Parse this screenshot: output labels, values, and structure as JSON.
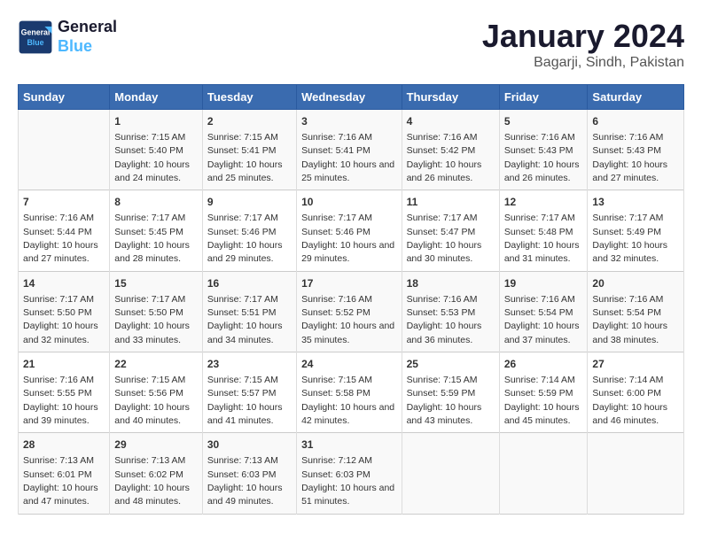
{
  "header": {
    "logo_line1": "General",
    "logo_line2": "Blue",
    "month_year": "January 2024",
    "location": "Bagarji, Sindh, Pakistan"
  },
  "weekdays": [
    "Sunday",
    "Monday",
    "Tuesday",
    "Wednesday",
    "Thursday",
    "Friday",
    "Saturday"
  ],
  "weeks": [
    [
      {
        "day": "",
        "sunrise": "",
        "sunset": "",
        "daylight": ""
      },
      {
        "day": "1",
        "sunrise": "7:15 AM",
        "sunset": "5:40 PM",
        "daylight": "10 hours and 24 minutes."
      },
      {
        "day": "2",
        "sunrise": "7:15 AM",
        "sunset": "5:41 PM",
        "daylight": "10 hours and 25 minutes."
      },
      {
        "day": "3",
        "sunrise": "7:16 AM",
        "sunset": "5:41 PM",
        "daylight": "10 hours and 25 minutes."
      },
      {
        "day": "4",
        "sunrise": "7:16 AM",
        "sunset": "5:42 PM",
        "daylight": "10 hours and 26 minutes."
      },
      {
        "day": "5",
        "sunrise": "7:16 AM",
        "sunset": "5:43 PM",
        "daylight": "10 hours and 26 minutes."
      },
      {
        "day": "6",
        "sunrise": "7:16 AM",
        "sunset": "5:43 PM",
        "daylight": "10 hours and 27 minutes."
      }
    ],
    [
      {
        "day": "7",
        "sunrise": "7:16 AM",
        "sunset": "5:44 PM",
        "daylight": "10 hours and 27 minutes."
      },
      {
        "day": "8",
        "sunrise": "7:17 AM",
        "sunset": "5:45 PM",
        "daylight": "10 hours and 28 minutes."
      },
      {
        "day": "9",
        "sunrise": "7:17 AM",
        "sunset": "5:46 PM",
        "daylight": "10 hours and 29 minutes."
      },
      {
        "day": "10",
        "sunrise": "7:17 AM",
        "sunset": "5:46 PM",
        "daylight": "10 hours and 29 minutes."
      },
      {
        "day": "11",
        "sunrise": "7:17 AM",
        "sunset": "5:47 PM",
        "daylight": "10 hours and 30 minutes."
      },
      {
        "day": "12",
        "sunrise": "7:17 AM",
        "sunset": "5:48 PM",
        "daylight": "10 hours and 31 minutes."
      },
      {
        "day": "13",
        "sunrise": "7:17 AM",
        "sunset": "5:49 PM",
        "daylight": "10 hours and 32 minutes."
      }
    ],
    [
      {
        "day": "14",
        "sunrise": "7:17 AM",
        "sunset": "5:50 PM",
        "daylight": "10 hours and 32 minutes."
      },
      {
        "day": "15",
        "sunrise": "7:17 AM",
        "sunset": "5:50 PM",
        "daylight": "10 hours and 33 minutes."
      },
      {
        "day": "16",
        "sunrise": "7:17 AM",
        "sunset": "5:51 PM",
        "daylight": "10 hours and 34 minutes."
      },
      {
        "day": "17",
        "sunrise": "7:16 AM",
        "sunset": "5:52 PM",
        "daylight": "10 hours and 35 minutes."
      },
      {
        "day": "18",
        "sunrise": "7:16 AM",
        "sunset": "5:53 PM",
        "daylight": "10 hours and 36 minutes."
      },
      {
        "day": "19",
        "sunrise": "7:16 AM",
        "sunset": "5:54 PM",
        "daylight": "10 hours and 37 minutes."
      },
      {
        "day": "20",
        "sunrise": "7:16 AM",
        "sunset": "5:54 PM",
        "daylight": "10 hours and 38 minutes."
      }
    ],
    [
      {
        "day": "21",
        "sunrise": "7:16 AM",
        "sunset": "5:55 PM",
        "daylight": "10 hours and 39 minutes."
      },
      {
        "day": "22",
        "sunrise": "7:15 AM",
        "sunset": "5:56 PM",
        "daylight": "10 hours and 40 minutes."
      },
      {
        "day": "23",
        "sunrise": "7:15 AM",
        "sunset": "5:57 PM",
        "daylight": "10 hours and 41 minutes."
      },
      {
        "day": "24",
        "sunrise": "7:15 AM",
        "sunset": "5:58 PM",
        "daylight": "10 hours and 42 minutes."
      },
      {
        "day": "25",
        "sunrise": "7:15 AM",
        "sunset": "5:59 PM",
        "daylight": "10 hours and 43 minutes."
      },
      {
        "day": "26",
        "sunrise": "7:14 AM",
        "sunset": "5:59 PM",
        "daylight": "10 hours and 45 minutes."
      },
      {
        "day": "27",
        "sunrise": "7:14 AM",
        "sunset": "6:00 PM",
        "daylight": "10 hours and 46 minutes."
      }
    ],
    [
      {
        "day": "28",
        "sunrise": "7:13 AM",
        "sunset": "6:01 PM",
        "daylight": "10 hours and 47 minutes."
      },
      {
        "day": "29",
        "sunrise": "7:13 AM",
        "sunset": "6:02 PM",
        "daylight": "10 hours and 48 minutes."
      },
      {
        "day": "30",
        "sunrise": "7:13 AM",
        "sunset": "6:03 PM",
        "daylight": "10 hours and 49 minutes."
      },
      {
        "day": "31",
        "sunrise": "7:12 AM",
        "sunset": "6:03 PM",
        "daylight": "10 hours and 51 minutes."
      },
      {
        "day": "",
        "sunrise": "",
        "sunset": "",
        "daylight": ""
      },
      {
        "day": "",
        "sunrise": "",
        "sunset": "",
        "daylight": ""
      },
      {
        "day": "",
        "sunrise": "",
        "sunset": "",
        "daylight": ""
      }
    ]
  ]
}
